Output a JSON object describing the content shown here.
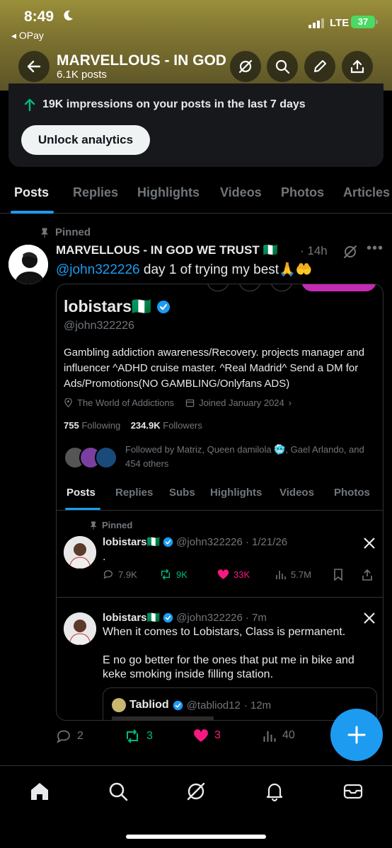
{
  "status_bar": {
    "time": "8:49",
    "back_app": "◂ OPay",
    "network": "LTE",
    "battery": "37"
  },
  "header": {
    "profile_name": "MARVELLOUS - IN GOD",
    "posts_count": "6.1K posts",
    "icons": [
      "back-arrow-icon",
      "grok-icon",
      "search-icon",
      "edit-icon",
      "share-icon"
    ]
  },
  "analytics": {
    "impressions_text": "19K impressions on your posts in the last 7 days",
    "unlock_label": "Unlock analytics"
  },
  "tabs": [
    "Posts",
    "Replies",
    "Highlights",
    "Videos",
    "Photos",
    "Articles"
  ],
  "active_tab": "Posts",
  "post": {
    "pinned_label": "Pinned",
    "author": "MARVELLOUS - IN GOD WE TRUST 🇳🇬",
    "time": "· 14h",
    "mention": "@john322226",
    "text": " day 1  of trying my best🙏🤲",
    "replies": "2",
    "reposts": "3",
    "likes": "3",
    "views": "40"
  },
  "embedded_profile": {
    "name": "lobistars🇳🇬",
    "handle": "@john322226",
    "bio": "Gambling addiction awareness/Recovery. projects manager and influencer ^ADHD cruise master. ^Real Madrid^ Send a DM for Ads/Promotions(NO GAMBLING/Onlyfans ADS)",
    "location": "The World of Addictions",
    "joined": "Joined January 2024",
    "following_count": "755",
    "following_label": "Following",
    "followers_count": "234.9K",
    "followers_label": "Followers",
    "followed_by": "Followed by Matriz, Queen damilola 🥶, Gael Arlando, and 454 others",
    "tabs": [
      "Posts",
      "Replies",
      "Subs",
      "Highlights",
      "Videos",
      "Photos"
    ],
    "pinned_label": "Pinned",
    "pinned_post": {
      "name": "lobistars🇳🇬",
      "handle": "@john322226",
      "date": "· 1/21/26",
      "text": ".",
      "replies": "7.9K",
      "reposts": "9K",
      "likes": "33K",
      "views": "5.7M"
    },
    "second_post": {
      "name": "lobistars🇳🇬",
      "handle": "@john322226",
      "time": "· 7m",
      "line1": "When it comes to Lobistars, Class is permanent.",
      "line2": "E no go better for the ones that put me in bike and keke smoking inside filling station."
    },
    "quote": {
      "name": "Tabliod",
      "handle": "@tabliod12",
      "time": "· 12m"
    }
  },
  "colors": {
    "accent": "#1d9bf0",
    "repost": "#00ba7c",
    "like": "#f91880",
    "header": "#7e7330"
  },
  "bottom_nav": [
    "home-icon",
    "search-icon",
    "grok-icon",
    "notifications-icon",
    "messages-icon"
  ]
}
